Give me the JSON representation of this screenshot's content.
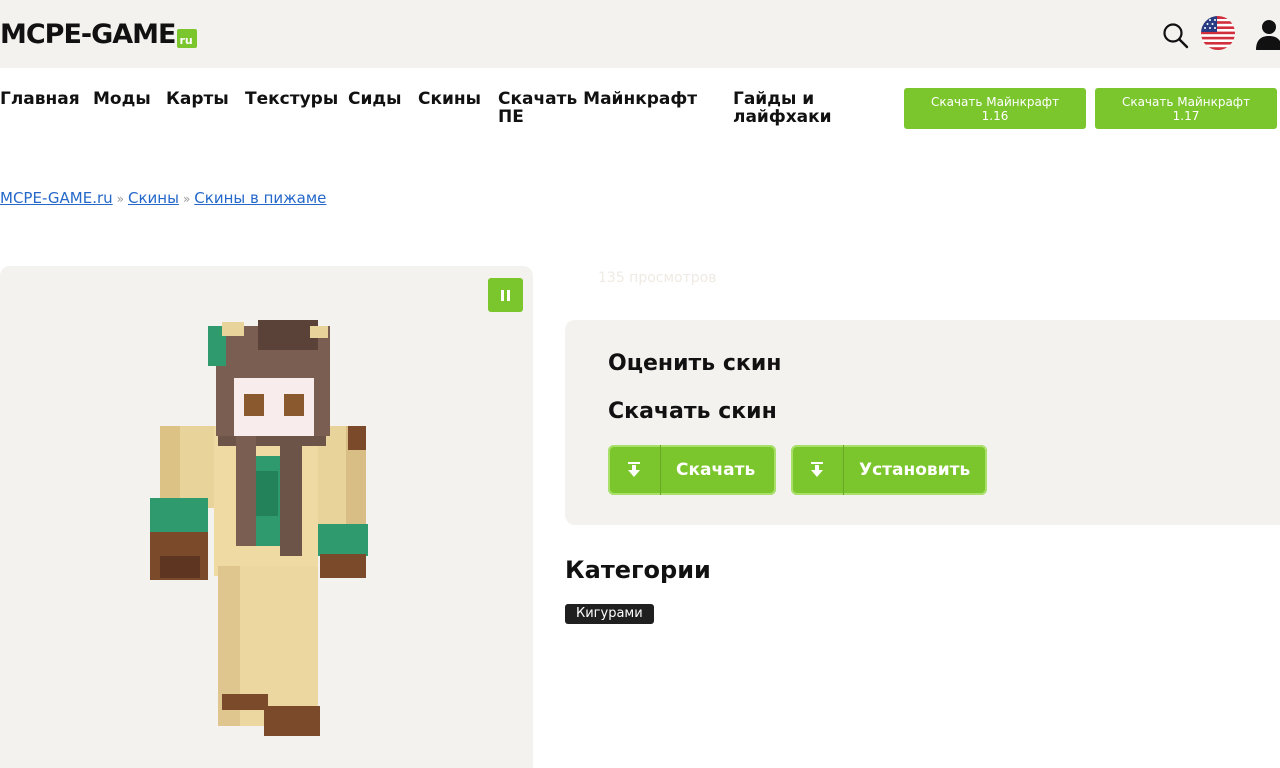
{
  "header": {
    "logo_main": "MCPE-GAME",
    "logo_suffix": "ru",
    "icons": [
      "search-icon",
      "us-flag-icon",
      "user-icon"
    ]
  },
  "nav": {
    "items": [
      "Главная",
      "Моды",
      "Карты",
      "Текстуры",
      "Сиды",
      "Скины",
      "Скачать Майнкрафт ПЕ",
      "Гайды и лайфхаки"
    ],
    "cta": [
      {
        "label": "Скачать Майнкрафт",
        "version": "1.16"
      },
      {
        "label": "Скачать Майнкрафт",
        "version": "1.17"
      }
    ]
  },
  "breadcrumb": [
    "MCPE-GAME.ru",
    "Скины",
    "Скины в пижаме"
  ],
  "breadcrumb_sep": "»",
  "preview": {
    "pause_icon": "pause-icon"
  },
  "stats": {
    "views": "135 просмотров"
  },
  "skin_panel": {
    "rate_title": "Оценить скин",
    "download_title": "Скачать скин",
    "download_button": "Скачать",
    "install_button": "Установить",
    "button_icon": "download-icon"
  },
  "categories": {
    "title": "Категории",
    "tags": [
      "Кигурами"
    ]
  },
  "colors": {
    "accent": "#7bc62d",
    "link": "#2568c9",
    "panel": "#f4f2ee",
    "tag_bg": "#1f1f1f"
  }
}
